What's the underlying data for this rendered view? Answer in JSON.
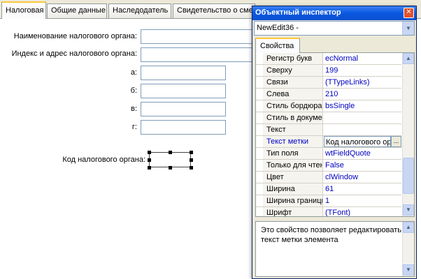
{
  "tabs": [
    {
      "label": "Налоговая",
      "active": true
    },
    {
      "label": "Общие данные",
      "active": false
    },
    {
      "label": "Наследодатель",
      "active": false
    },
    {
      "label": "Свидетельство о смерти",
      "active": false
    }
  ],
  "form": {
    "tax_name_label": "Наименование налогового органа:",
    "tax_address_label": "Индекс и адрес налогового органа:",
    "line_a_label": "а:",
    "line_b_label": "б:",
    "line_v_label": "в:",
    "line_g_label": "г:",
    "tax_code_label": "Код налогового органа:"
  },
  "inspector": {
    "title": "Объектный инспектор",
    "close_glyph": "✕",
    "selected_object": "NewEdit36 -",
    "tab_label": "Свойства",
    "properties": [
      {
        "name": "Регистр букв",
        "value": "ecNormal"
      },
      {
        "name": "Сверху",
        "value": "199"
      },
      {
        "name": "Связи",
        "value": "(TTypeLinks)"
      },
      {
        "name": "Слева",
        "value": "210"
      },
      {
        "name": "Стиль бордюра",
        "value": "bsSingle"
      },
      {
        "name": "Стиль в документе",
        "value": ""
      },
      {
        "name": "Текст",
        "value": ""
      },
      {
        "name": "Текст метки",
        "value": "Код налогового органа:"
      },
      {
        "name": "Тип поля",
        "value": "wtFieldQuote"
      },
      {
        "name": "Только для чтения",
        "value": "False"
      },
      {
        "name": "Цвет",
        "value": "clWindow"
      },
      {
        "name": "Ширина",
        "value": "61"
      },
      {
        "name": "Ширина границы",
        "value": "1"
      },
      {
        "name": "Шрифт",
        "value": "(TFont)"
      }
    ],
    "ellipsis": "...",
    "description": "Это свойство позволяет редактировать текст метки элемента"
  }
}
